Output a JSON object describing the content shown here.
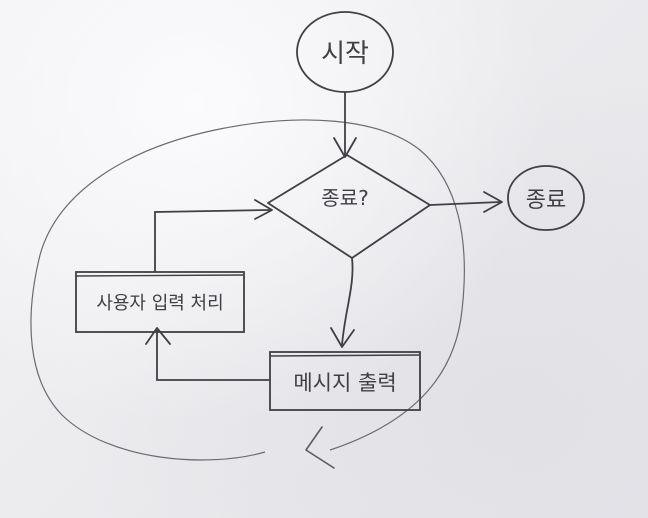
{
  "diagram": {
    "start_label": "시작",
    "decision_label": "종료?",
    "end_label": "종료",
    "process_input_label": "사용자 입력 처리",
    "process_output_label": "메시지 출력"
  },
  "colors": {
    "ink": "#3f3f44",
    "thin_ink": "#6a6a70",
    "whiteboard": "#efeff2"
  }
}
